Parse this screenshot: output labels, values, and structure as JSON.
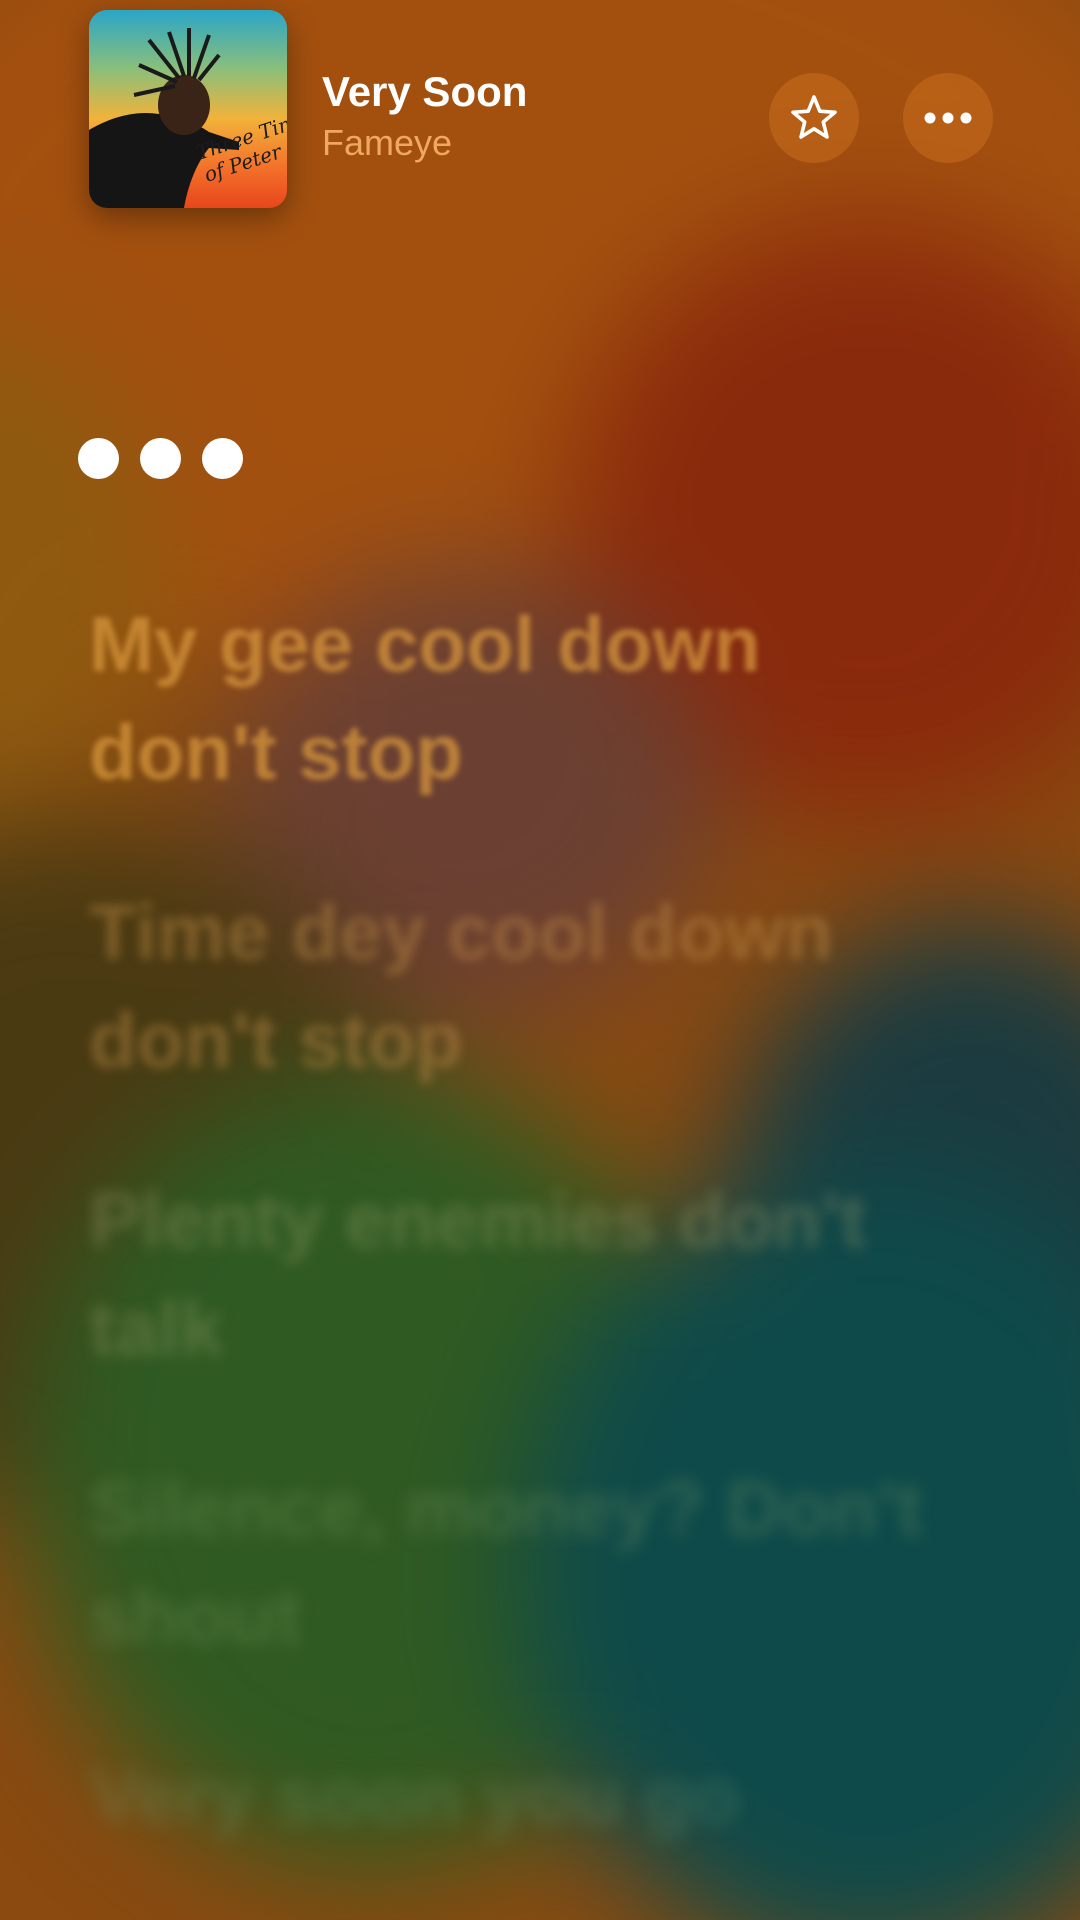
{
  "now_playing": {
    "title": "Very Soon",
    "artist": "Fameye",
    "artwork": {
      "icon": "album-artwork",
      "text_line1": "Three Times",
      "text_line2": "of Peter"
    }
  },
  "actions": {
    "favorite_icon": "star-outline-icon",
    "more_icon": "ellipsis-icon"
  },
  "lyrics": [
    "My gee cool down don't stop",
    "Time dey cool down don't stop",
    "Plenty enemies don't talk",
    "Silence, money? Don't shout",
    "Very soon you go"
  ],
  "colors": {
    "background": "#a3500f",
    "artist_text": "#f0a85e",
    "title_text": "#ffffff"
  }
}
